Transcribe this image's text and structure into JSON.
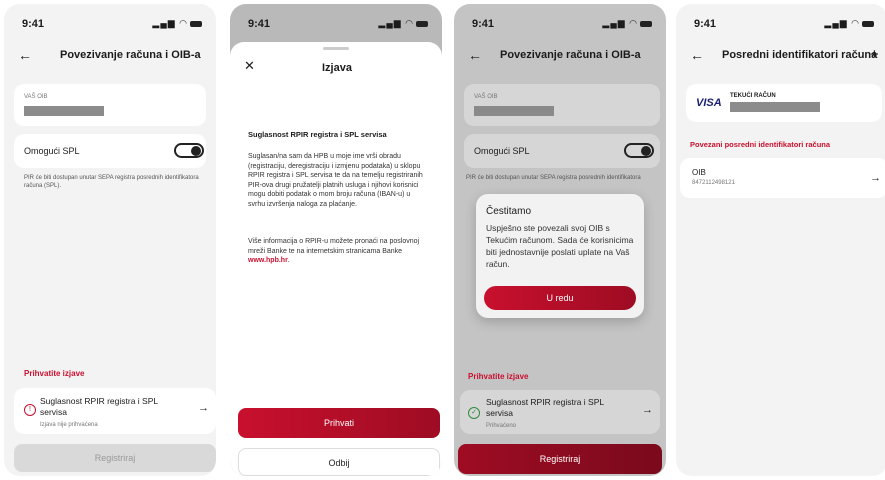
{
  "status": {
    "time": "9:41",
    "signal": "▂▄▆ ●"
  },
  "screen1": {
    "title": "Povezivanje računa i OIB-a",
    "oib_label": "VAŠ OIB",
    "spl_label": "Omogući SPL",
    "spl_note": "PIR će biti dostupan unutar SEPA registra posrednih identifikatora računa (SPL).",
    "accept_title": "Prihvatite izjave",
    "consent_title": "Suglasnost RPIR registra i SPL servisa",
    "consent_status": "Izjava nije prihvaćena",
    "register_button": "Registriraj"
  },
  "screen2": {
    "title": "Izjava",
    "heading": "Suglasnost RPIR registra i SPL servisa",
    "para1": "Suglasan/na sam da HPB u moje ime vrši obradu (registraciju, deregistraciju i izmjenu podataka) u sklopu RPIR registra i SPL servisa te da na temelju registriranih PIR-ova drugi pružatelji platnih usluga i njihovi korisnici mogu dobiti podatak o mom broju računa (IBAN-u) u svrhu izvršenja naloga za plaćanje.",
    "para2": "Više informacija o RPIR-u možete pronaći na poslovnoj mreži Banke te na internetskim stranicama Banke ",
    "link": "www.hpb.hr",
    "link_suffix": ".",
    "accept_button": "Prihvati",
    "decline_button": "Odbij"
  },
  "screen3": {
    "title": "Povezivanje računa i OIB-a",
    "oib_label": "VAŠ OIB",
    "spl_label": "Omogući SPL",
    "spl_note": "PIR će biti dostupan unutar SEPA registra posrednih identifikatora",
    "modal_title": "Čestitamo",
    "modal_text": "Uspješno ste povezali svoj OIB s Tekućim računom. Sada će korisnicima biti jednostavnije poslati uplate na Vaš račun.",
    "modal_button": "U redu",
    "accept_title": "Prihvatite izjave",
    "consent_title": "Suglasnost RPIR registra i SPL servisa",
    "consent_status": "Prihvaćeno",
    "register_button": "Registriraj"
  },
  "screen4": {
    "title": "Posredni identifikatori računa",
    "card_brand": "VISA",
    "account_type": "TEKUĆI RAČUN",
    "section_title": "Povezani posredni identifikatori računa",
    "item_label": "OIB",
    "item_value": "84721124981​21"
  },
  "colors": {
    "brand_red": "#c8102e",
    "visa_blue": "#1a1f71"
  }
}
